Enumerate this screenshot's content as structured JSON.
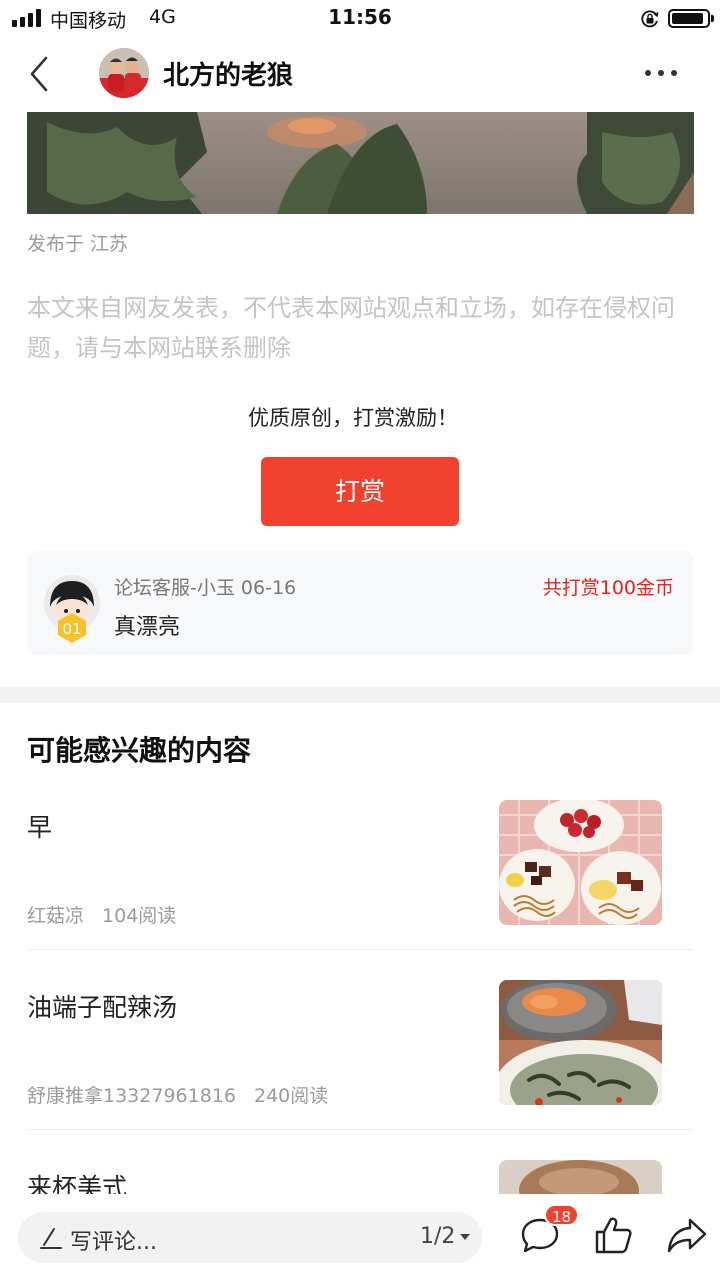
{
  "status_bar": {
    "carrier": "中国移动",
    "network": "4G",
    "time": "11:56"
  },
  "nav": {
    "title": "北方的老狼"
  },
  "article": {
    "publish_location": "发布于 江苏",
    "disclaimer": "本文来自网友发表，不代表本网站观点和立场，如存在侵权问题，请与本网站联系删除"
  },
  "reward": {
    "prompt": "优质原创，打赏激励！",
    "button_label": "打赏"
  },
  "tip_record": {
    "rank": "01",
    "user": "论坛客服-小玉",
    "date": "06-16",
    "comment": "真漂亮",
    "total": "共打赏100金币"
  },
  "recommendations": {
    "title": "可能感兴趣的内容",
    "items": [
      {
        "title": "早",
        "author": "红菇凉",
        "reads": "104阅读"
      },
      {
        "title": "油端子配辣汤",
        "author": "舒康推拿13327961816",
        "reads": "240阅读"
      },
      {
        "title": "来杯美式",
        "author": "",
        "reads": ""
      }
    ]
  },
  "bottom_bar": {
    "comment_placeholder": "写评论...",
    "page_indicator": "1/2",
    "comment_count": "18"
  },
  "colors": {
    "accent": "#f0402e",
    "tip_total": "#e0241d"
  },
  "icons": [
    "signal-icon",
    "lock-rotation-icon",
    "battery-icon",
    "back-arrow-icon",
    "more-icon",
    "pencil-icon",
    "comment-icon",
    "like-icon",
    "share-icon"
  ]
}
